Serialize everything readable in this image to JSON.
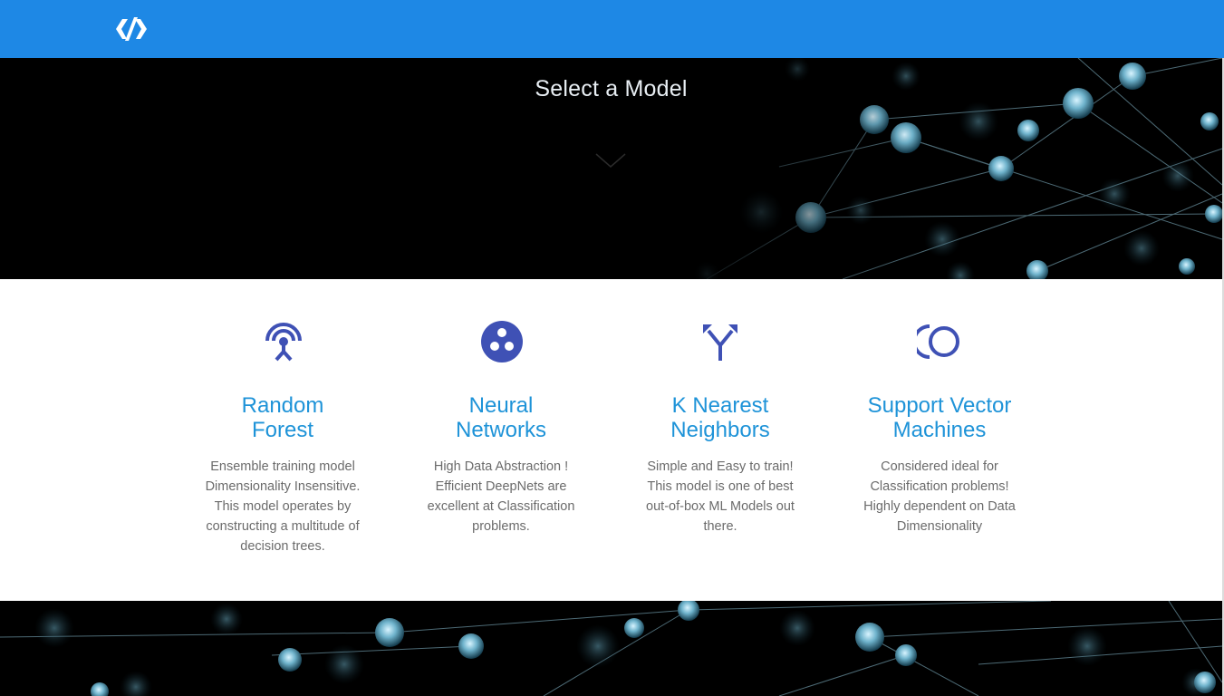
{
  "hero": {
    "title": "Select a Model"
  },
  "models": [
    {
      "title_line1": "Random",
      "title_line2": "Forest",
      "icon": "antenna-icon",
      "description": "Ensemble training model Dimensionality Insensitive. This model operates by constructing a multitude of decision trees."
    },
    {
      "title_line1": "Neural",
      "title_line2": "Networks",
      "icon": "three-dots-circle-icon",
      "description": "High Data Abstraction ! Efficient DeepNets are excellent at Classification problems."
    },
    {
      "title_line1": "K Nearest",
      "title_line2": "Neighbors",
      "icon": "merge-arrows-icon",
      "description": "Simple and Easy to train! This model is one of best out-of-box ML Models out there."
    },
    {
      "title_line1": "Support Vector",
      "title_line2": "Machines",
      "icon": "double-circle-icon",
      "description": "Considered ideal for Classification problems! Highly dependent on Data Dimensionality"
    }
  ],
  "colors": {
    "navbar": "#1e88e5",
    "accent": "#1e93d8",
    "icon": "#3f51b5",
    "text": "#6b6b6b"
  }
}
